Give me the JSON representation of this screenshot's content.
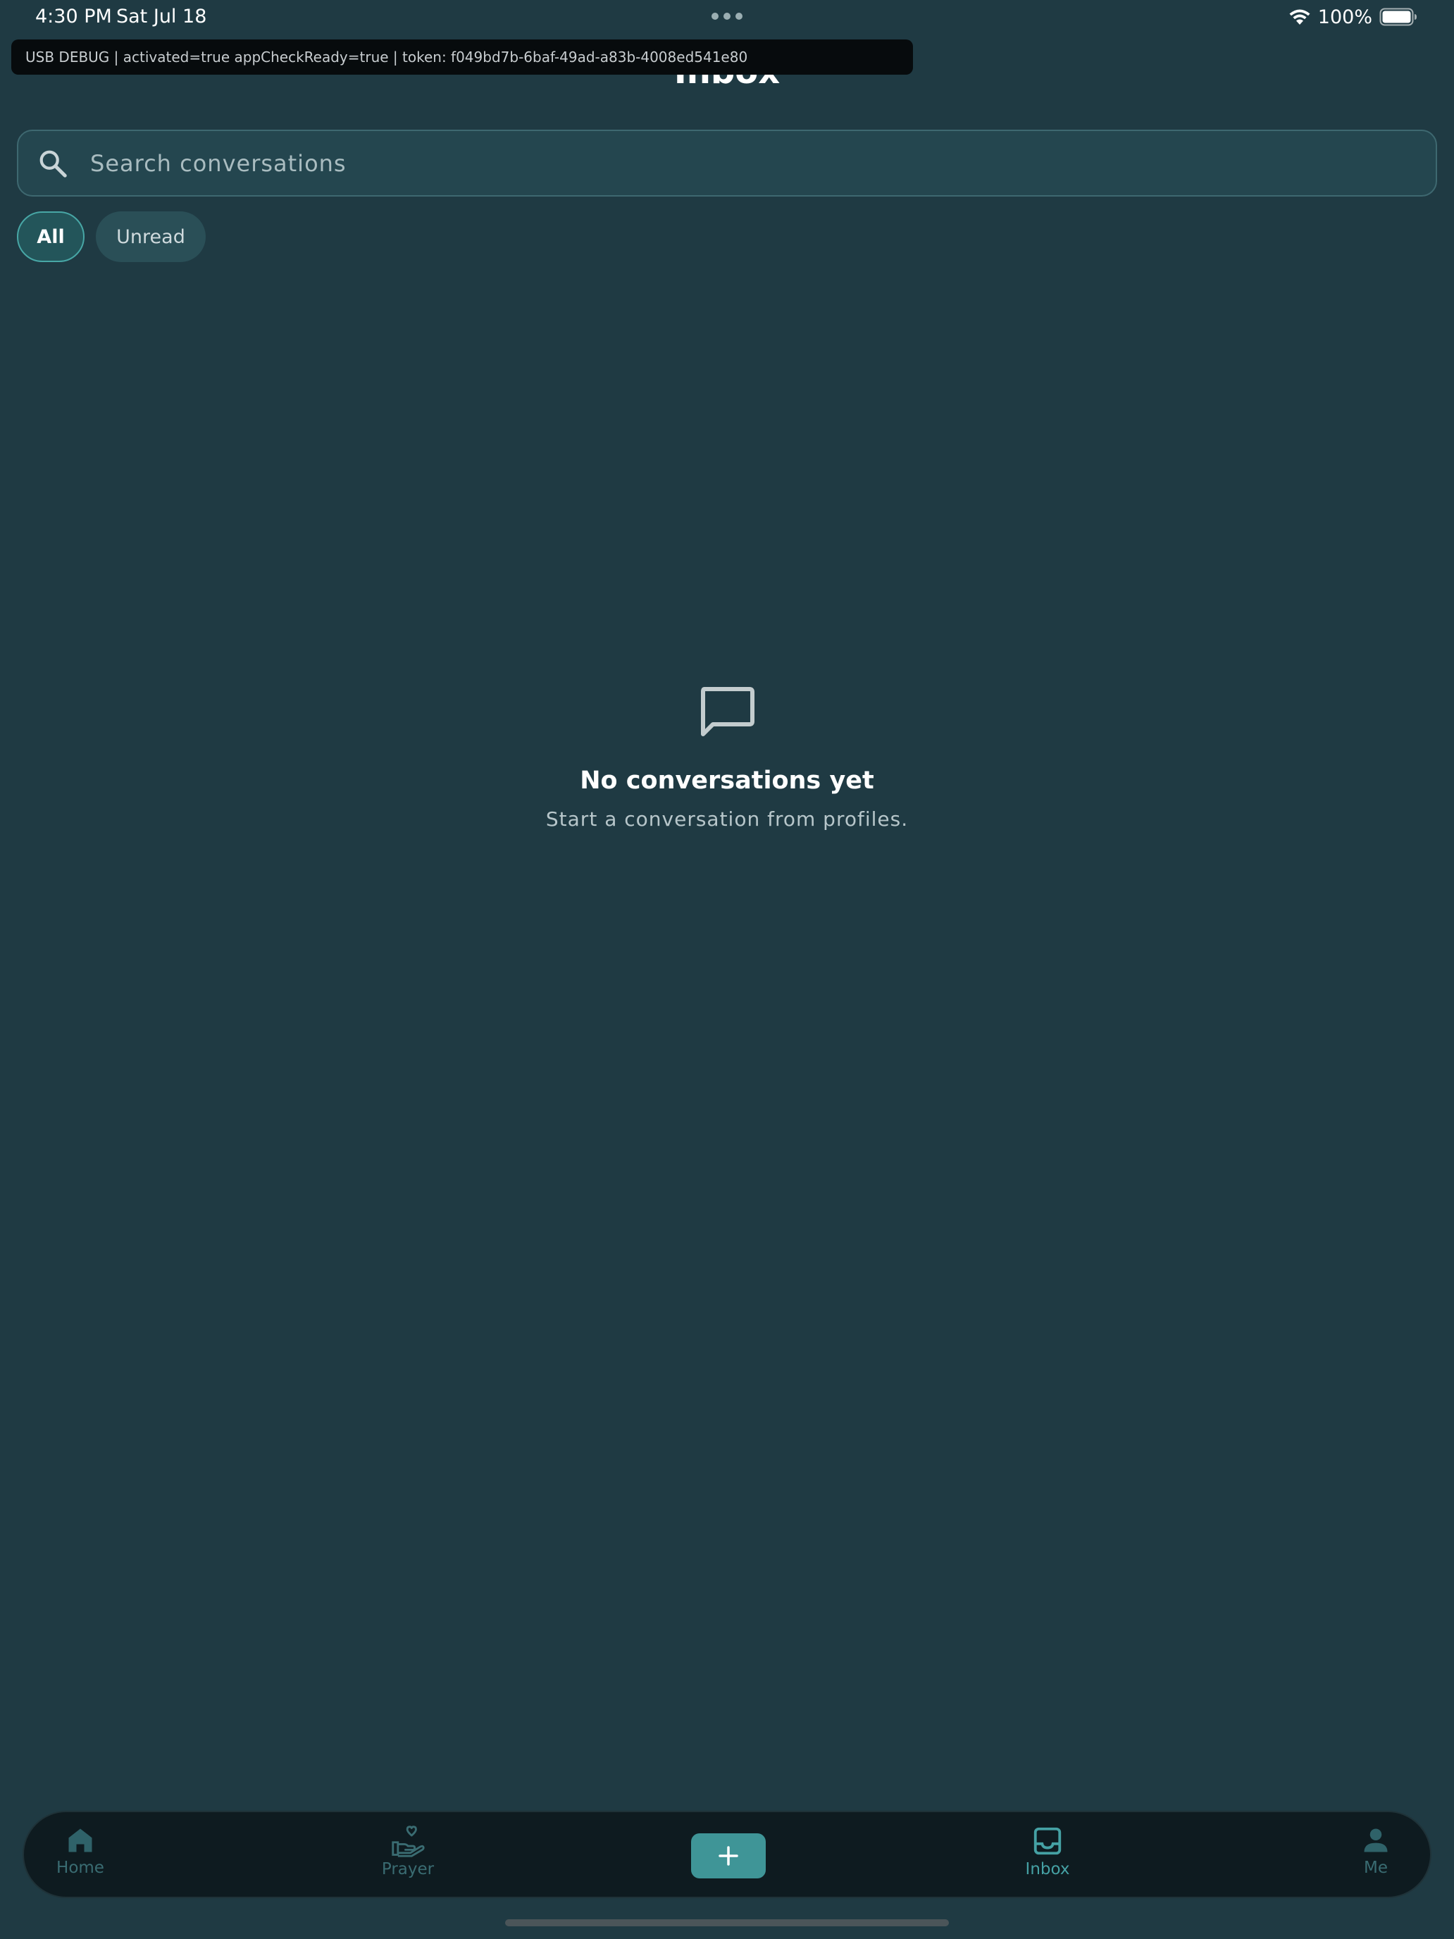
{
  "status_bar": {
    "time": "4:30 PM",
    "date": "Sat Jul 18",
    "battery": "100%"
  },
  "debug_banner": {
    "text": "USB DEBUG | activated=true appCheckReady=true | token: f049bd7b-6baf-49ad-a83b-4008ed541e80"
  },
  "header": {
    "title": "Inbox"
  },
  "search": {
    "placeholder": "Search conversations",
    "value": "",
    "icon": "search-icon"
  },
  "filters": {
    "all_label": "All",
    "unread_label": "Unread",
    "selected": "All"
  },
  "empty_state": {
    "icon": "chat-bubble-icon",
    "title": "No conversations yet",
    "subtitle": "Start a conversation from profiles."
  },
  "bottom_nav": {
    "home_label": "Home",
    "prayer_label": "Prayer",
    "inbox_label": "Inbox",
    "me_label": "Me",
    "active": "Inbox"
  },
  "colors": {
    "background": "#1f3a43",
    "accent": "#45a1a4",
    "nav_background": "#0e1b20",
    "add_button": "#3f9597"
  }
}
